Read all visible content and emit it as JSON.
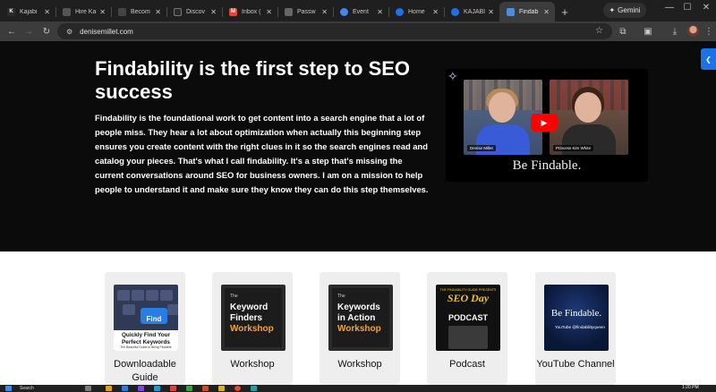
{
  "tabs": [
    {
      "title": "Kajabi",
      "favicon": "K",
      "color": "#2b2b2b"
    },
    {
      "title": "Hire Ka",
      "favicon": "",
      "color": "#2b2b2b"
    },
    {
      "title": "Becom",
      "favicon": "",
      "color": "#444"
    },
    {
      "title": "Discov",
      "favicon": "",
      "color": "#2b2b2b"
    },
    {
      "title": "Inbox (",
      "favicon": "M",
      "color": "#ea4335"
    },
    {
      "title": "Passw",
      "favicon": "",
      "color": "#555"
    },
    {
      "title": "Event",
      "favicon": "",
      "color": "#4285f4"
    },
    {
      "title": "Home",
      "favicon": "",
      "color": "#1a73e8"
    },
    {
      "title": "KAJABI",
      "favicon": "",
      "color": "#1a73e8"
    },
    {
      "title": "Findab",
      "favicon": "",
      "color": "#4a90d9"
    }
  ],
  "browser": {
    "gemini_label": "Gemini",
    "url": "denisemillet.com"
  },
  "hero": {
    "title": "Findability is the first step to SEO success",
    "body": "Findability is the foundational work to get content into a search engine that a lot of people miss. They hear a lot about optimization when actually this beginning step ensures you create content with the right clues in it so the search engines read and catalog your pieces. That's what I call findability.  It's a step that's missing the current conversations around SEO for business owners.  I am on a mission to help people to understand it and make sure they know they can do this step themselves.",
    "video": {
      "left_name": "Denise Millet",
      "right_name": "Princess Kim White",
      "caption": "Be Findable."
    }
  },
  "cards": [
    {
      "label": "Downloadable Guide",
      "thumb_find": "Find",
      "thumb_main": "Quickly Find Your Perfect Keywords",
      "thumb_sub": "The Beautiful Guide to Being Findable"
    },
    {
      "label": "Workshop",
      "thumb_tag": "The",
      "thumb_l1": "Keyword",
      "thumb_l2": "Finders",
      "thumb_l3": "Workshop"
    },
    {
      "label": "Workshop",
      "thumb_tag": "The",
      "thumb_l1": "Keywords",
      "thumb_l2": "in Action",
      "thumb_l3": "Workshop"
    },
    {
      "label": "Podcast",
      "thumb_tag": "THE FINDABILITY GUIDE PRESENTS",
      "thumb_title": "SEO Day",
      "thumb_word": "PODCAST"
    },
    {
      "label": "YouTube Channel",
      "thumb_title": "Be Findable.",
      "thumb_handle": "YouTube @findabilityqueen"
    }
  ],
  "taskbar": {
    "search_label": "Search",
    "time": "1:20 PM"
  },
  "colors": {
    "hero_bg": "#0b0b0b",
    "accent_blue": "#1a73e8",
    "workshop_orange": "#f2a23b",
    "podcast_gold": "#f2c230"
  }
}
